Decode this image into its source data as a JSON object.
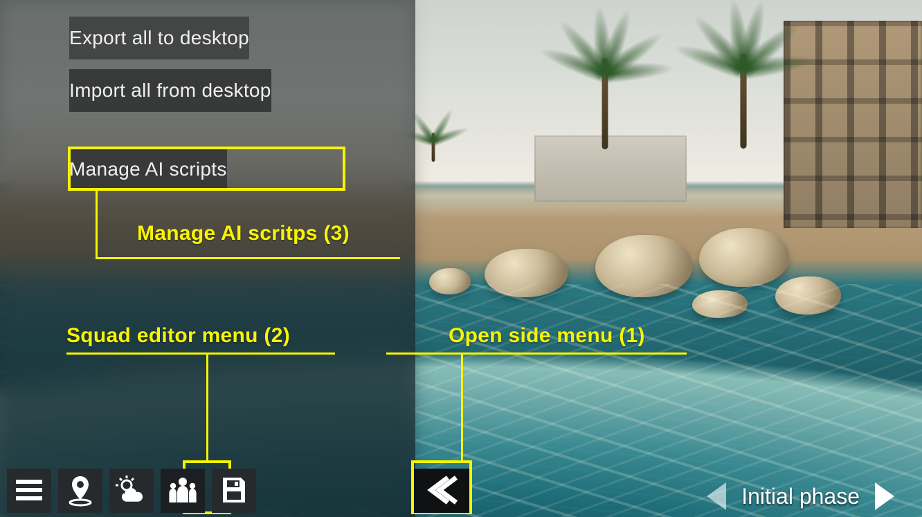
{
  "panel": {
    "export_label": "Export all to desktop",
    "import_label": "Import all from desktop",
    "manage_ai_label": "Manage AI scripts"
  },
  "annotations": {
    "manage_ai": "Manage AI scritps (3)",
    "squad_menu": "Squad editor menu (2)",
    "open_side": "Open side menu  (1)"
  },
  "toolbar": {
    "menu": "menu-icon",
    "location": "location-pin-icon",
    "weather": "weather-icon",
    "squad": "squad-editor-icon",
    "save": "save-icon"
  },
  "open_menu_btn": "open-side-menu",
  "phase": {
    "label": "Initial phase"
  },
  "colors": {
    "highlight": "#f7f500",
    "panel_button": "#444646"
  }
}
